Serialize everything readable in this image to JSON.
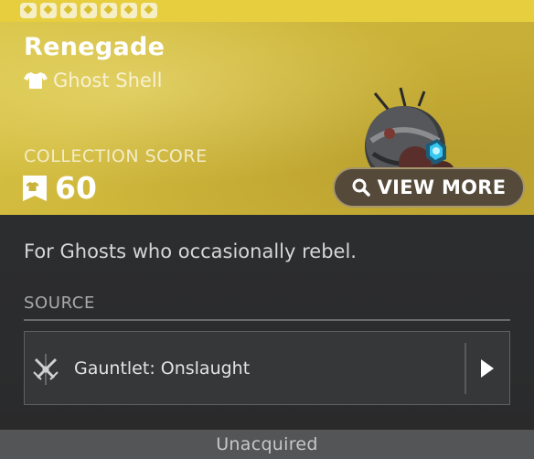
{
  "item": {
    "name": "Renegade",
    "type_label": "Ghost Shell",
    "type_icon": "shirt-icon",
    "description": "For Ghosts who occasionally rebel."
  },
  "collection": {
    "label": "COLLECTION SCORE",
    "score": "60",
    "icon": "collection-badge-icon"
  },
  "actions": {
    "view_more_label": "VIEW MORE",
    "view_more_icon": "search-icon"
  },
  "source": {
    "label": "SOURCE",
    "entries": [
      {
        "name": "Gauntlet: Onslaught",
        "icon": "crossed-swords-icon",
        "arrow_icon": "play-arrow-icon"
      }
    ]
  },
  "status": {
    "text": "Unacquired"
  },
  "colors": {
    "rarity_accent": "#d8c445",
    "panel_background": "#2c2d2e",
    "status_bar": "#545556"
  }
}
